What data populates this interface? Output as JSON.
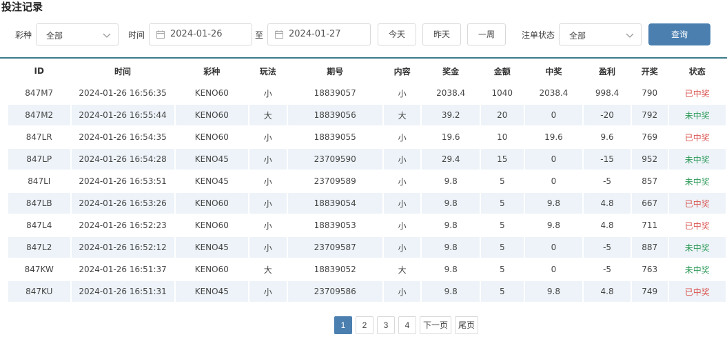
{
  "title": "投注记录",
  "filters": {
    "lottery_label": "彩种",
    "lottery_value": "全部",
    "time_label": "时间",
    "date_from": "2024-01-26",
    "to_label": "至",
    "date_to": "2024-01-27",
    "today_label": "今天",
    "yesterday_label": "昨天",
    "week_label": "一周",
    "status_label": "注单状态",
    "status_value": "全部",
    "query_label": "查询"
  },
  "table": {
    "headers": [
      "ID",
      "时间",
      "彩种",
      "玩法",
      "期号",
      "内容",
      "奖金",
      "金额",
      "中奖",
      "盈利",
      "开奖",
      "状态"
    ],
    "rows": [
      [
        "847M7",
        "2024-01-26 16:56:35",
        "KENO60",
        "小",
        "18839057",
        "小",
        "2038.4",
        "1040",
        "2038.4",
        "998.4",
        "790",
        "已中奖"
      ],
      [
        "847M2",
        "2024-01-26 16:55:44",
        "KENO60",
        "大",
        "18839056",
        "大",
        "39.2",
        "20",
        "0",
        "-20",
        "792",
        "未中奖"
      ],
      [
        "847LR",
        "2024-01-26 16:54:35",
        "KENO60",
        "小",
        "18839055",
        "小",
        "19.6",
        "10",
        "19.6",
        "9.6",
        "769",
        "已中奖"
      ],
      [
        "847LP",
        "2024-01-26 16:54:28",
        "KENO45",
        "小",
        "23709590",
        "小",
        "29.4",
        "15",
        "0",
        "-15",
        "952",
        "未中奖"
      ],
      [
        "847LI",
        "2024-01-26 16:53:51",
        "KENO45",
        "小",
        "23709589",
        "小",
        "9.8",
        "5",
        "0",
        "-5",
        "857",
        "未中奖"
      ],
      [
        "847LB",
        "2024-01-26 16:53:26",
        "KENO60",
        "小",
        "18839054",
        "小",
        "9.8",
        "5",
        "9.8",
        "4.8",
        "667",
        "已中奖"
      ],
      [
        "847L4",
        "2024-01-26 16:52:23",
        "KENO60",
        "小",
        "18839053",
        "小",
        "9.8",
        "5",
        "9.8",
        "4.8",
        "711",
        "已中奖"
      ],
      [
        "847L2",
        "2024-01-26 16:52:12",
        "KENO45",
        "小",
        "23709587",
        "小",
        "9.8",
        "5",
        "0",
        "-5",
        "887",
        "未中奖"
      ],
      [
        "847KW",
        "2024-01-26 16:51:37",
        "KENO60",
        "大",
        "18839052",
        "大",
        "9.8",
        "5",
        "0",
        "-5",
        "763",
        "未中奖"
      ],
      [
        "847KU",
        "2024-01-26 16:51:31",
        "KENO45",
        "小",
        "23709586",
        "小",
        "9.8",
        "5",
        "9.8",
        "4.8",
        "749",
        "已中奖"
      ]
    ]
  },
  "status_colors": {
    "已中奖": "#d9534f",
    "未中奖": "#2e9a5a"
  },
  "pagination": {
    "pages": [
      "1",
      "2",
      "3",
      "4"
    ],
    "current": "1",
    "next_label": "下一页",
    "last_label": "尾页"
  }
}
